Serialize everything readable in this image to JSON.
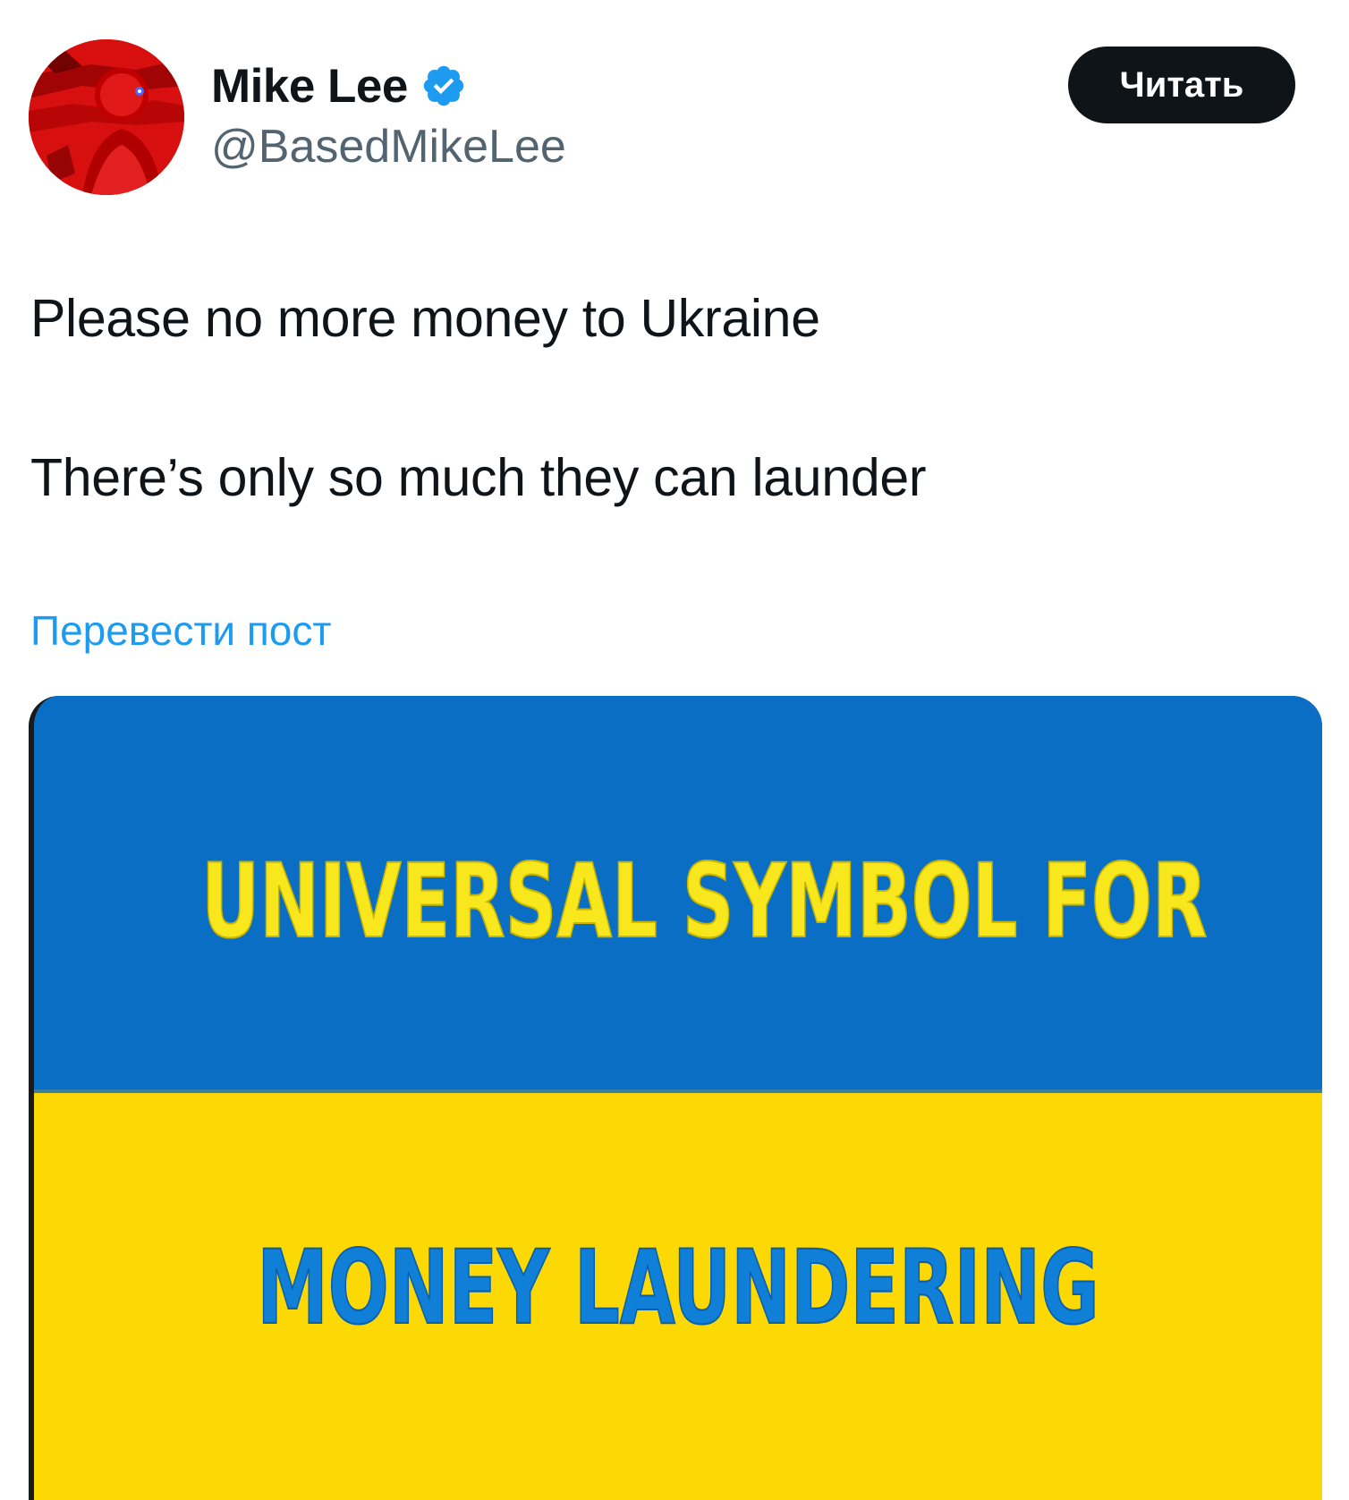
{
  "post": {
    "author": {
      "display_name": "Mike Lee",
      "handle": "@BasedMikeLee",
      "verified": true,
      "avatar_icon": "avatar-red-portrait"
    },
    "follow_button_label": "Читать",
    "text_lines": [
      "Please no more money to Ukraine",
      "There’s only so much they can launder"
    ],
    "translate_link": "Перевести пост",
    "media": {
      "top_text": "UNIVERSAL SYMBOL FOR",
      "bottom_text": "MONEY LAUNDERING",
      "colors": {
        "blue": "#0a6fc4",
        "yellow": "#fcd905"
      }
    }
  },
  "colors": {
    "text_primary": "#0f1419",
    "text_secondary": "#536471",
    "link": "#1d9bf0",
    "button_bg": "#0f1419",
    "verified_badge": "#1d9bf0"
  }
}
